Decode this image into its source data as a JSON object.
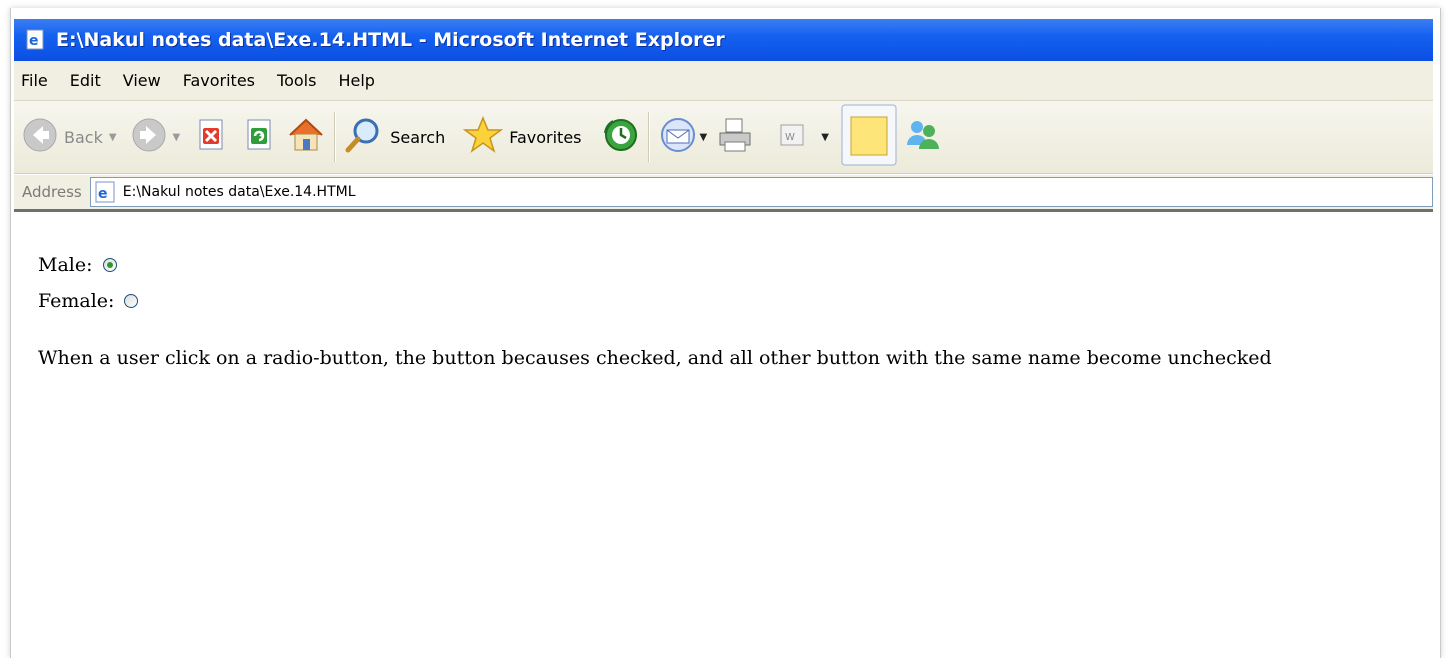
{
  "window": {
    "title": "E:\\Nakul notes data\\Exe.14.HTML - Microsoft Internet Explorer"
  },
  "menu": {
    "items": [
      "File",
      "Edit",
      "View",
      "Favorites",
      "Tools",
      "Help"
    ]
  },
  "toolbar": {
    "back_label": "Back",
    "search_label": "Search",
    "favorites_label": "Favorites"
  },
  "address": {
    "label": "Address",
    "value": "E:\\Nakul notes data\\Exe.14.HTML"
  },
  "content": {
    "male_label": "Male:",
    "male_checked": true,
    "female_label": "Female:",
    "female_checked": false,
    "paragraph": "When a user click on a radio-button, the button becauses checked, and all other button with the same name become unchecked"
  },
  "colors": {
    "titlebar": "#0b4fe2",
    "chrome": "#f1efe2",
    "radio_dot": "#2e9a2e"
  }
}
